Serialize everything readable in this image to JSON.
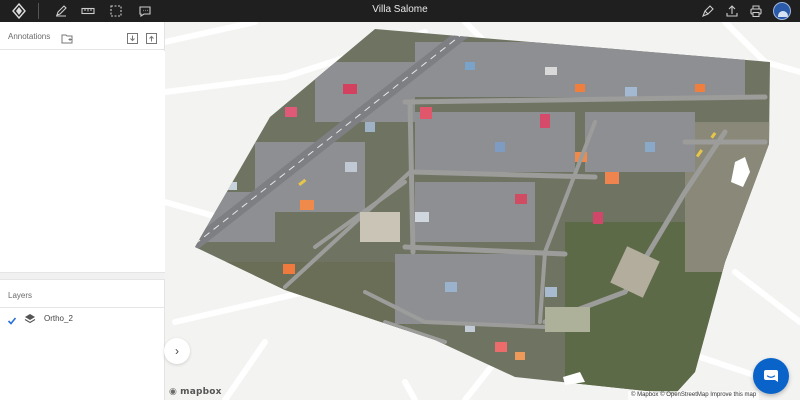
{
  "app": {
    "title": "Villa Salome",
    "logo_icon": "diamond-logo-icon",
    "toolbar": [
      {
        "icon": "pencil-icon"
      },
      {
        "icon": "ruler-icon"
      },
      {
        "icon": "selection-box-icon"
      },
      {
        "icon": "comment-icon"
      }
    ],
    "right_tools": [
      {
        "icon": "brush-icon"
      },
      {
        "icon": "upload-icon"
      },
      {
        "icon": "print-icon"
      }
    ],
    "avatar_icon": "user-avatar-icon"
  },
  "sidebar": {
    "annotations": {
      "title": "Annotations",
      "folder_icon": "add-folder-icon",
      "import_icon": "import-icon",
      "export_icon": "export-icon"
    },
    "layers": {
      "title": "Layers",
      "items": [
        {
          "name": "Ortho_2",
          "checked": true,
          "icon": "layers-icon"
        }
      ]
    }
  },
  "map": {
    "collapse_label": "›",
    "provider": "mapbox",
    "attribution": "© Mapbox © OpenStreetMap  Improve this map",
    "chat_icon": "chat-bubble-icon"
  },
  "colors": {
    "topbar": "#1f1f1f",
    "accent": "#0a63c9",
    "check": "#2a6fd6"
  }
}
